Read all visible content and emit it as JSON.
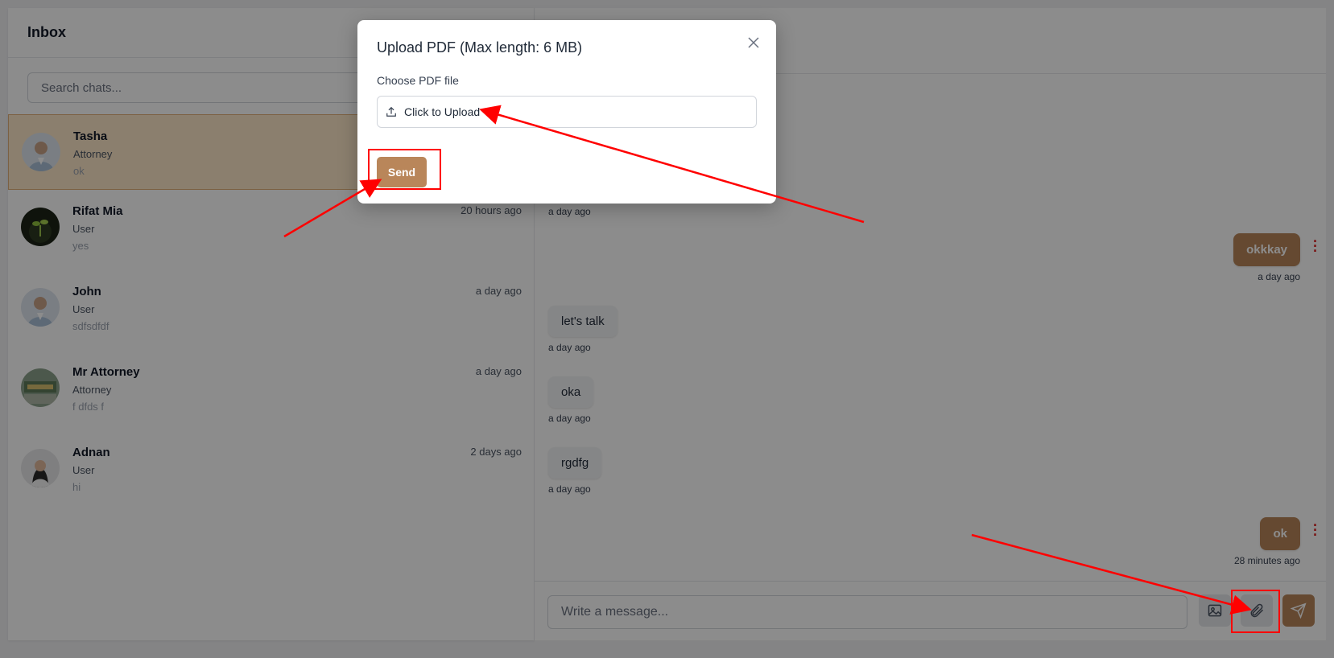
{
  "sidebar": {
    "title": "Inbox",
    "search_placeholder": "Search chats...",
    "chats": [
      {
        "name": "Tasha",
        "role": "Attorney",
        "preview": "ok",
        "time": "",
        "active": true
      },
      {
        "name": "Rifat Mia",
        "role": "User",
        "preview": "yes",
        "time": "20 hours ago"
      },
      {
        "name": "John",
        "role": "User",
        "preview": "sdfsdfdf",
        "time": "a day ago"
      },
      {
        "name": "Mr Attorney",
        "role": "Attorney",
        "preview": "f dfds f",
        "time": "a day ago"
      },
      {
        "name": "Adnan",
        "role": "User",
        "preview": "hi",
        "time": "2 days ago"
      }
    ]
  },
  "messages": [
    {
      "text": "",
      "time": "a day ago",
      "dir": "in"
    },
    {
      "text": "okkkay",
      "time": "a day ago",
      "dir": "out"
    },
    {
      "text": "let's talk",
      "time": "a day ago",
      "dir": "in"
    },
    {
      "text": "oka",
      "time": "a day ago",
      "dir": "in"
    },
    {
      "text": "rgdfg",
      "time": "a day ago",
      "dir": "in"
    },
    {
      "text": "ok",
      "time": "28 minutes ago",
      "dir": "out"
    }
  ],
  "composer": {
    "placeholder": "Write a message..."
  },
  "modal": {
    "title": "Upload PDF (Max length: 6 MB)",
    "label": "Choose PDF file",
    "upload_text": "Click to Upload",
    "send_label": "Send"
  },
  "colors": {
    "accent": "#b9865a",
    "active_chat": "#fde8c8",
    "annotation": "#ff0000"
  }
}
